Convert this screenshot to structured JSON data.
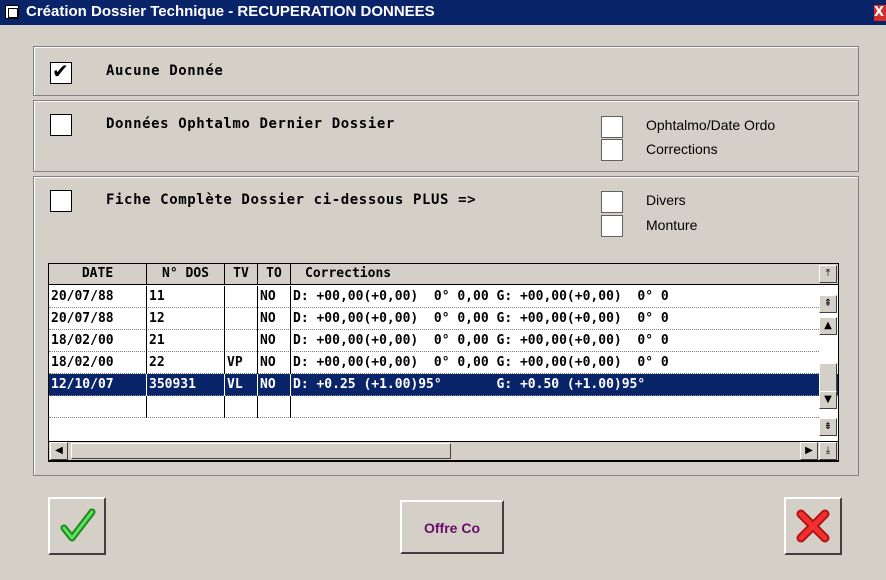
{
  "window": {
    "title": "Création Dossier Technique - RECUPERATION DONNEES",
    "close_glyph": "X"
  },
  "options": {
    "aucune": {
      "label": "Aucune Donnée",
      "checked": true
    },
    "ophtalmo_dernier": {
      "label": "Données Ophtalmo Dernier Dossier",
      "checked": false
    },
    "ophtalmo_date_ordo": {
      "label": "Ophtalmo/Date Ordo",
      "checked": false
    },
    "corrections": {
      "label": "Corrections",
      "checked": false
    },
    "fiche_complete": {
      "label": "Fiche Complète Dossier ci-dessous PLUS =>",
      "checked": false
    },
    "divers": {
      "label": "Divers",
      "checked": false
    },
    "monture": {
      "label": "Monture",
      "checked": false
    }
  },
  "table": {
    "headers": {
      "date": "DATE",
      "dos": "N° DOS",
      "tv": "TV",
      "to": "TO",
      "corrections": "Corrections"
    },
    "rows": [
      {
        "date": "20/07/88",
        "dos": "11",
        "tv": "",
        "to": "NO",
        "corrections": "D: +00,00(+0,00)  0° 0,00 G: +00,00(+0,00)  0° 0"
      },
      {
        "date": "20/07/88",
        "dos": "12",
        "tv": "",
        "to": "NO",
        "corrections": "D: +00,00(+0,00)  0° 0,00 G: +00,00(+0,00)  0° 0"
      },
      {
        "date": "18/02/00",
        "dos": "21",
        "tv": "",
        "to": "NO",
        "corrections": "D: +00,00(+0,00)  0° 0,00 G: +00,00(+0,00)  0° 0"
      },
      {
        "date": "18/02/00",
        "dos": "22",
        "tv": "VP",
        "to": "NO",
        "corrections": "D: +00,00(+0,00)  0° 0,00 G: +00,00(+0,00)  0° 0"
      },
      {
        "date": "12/10/07",
        "dos": "350931",
        "tv": "VL",
        "to": "NO",
        "corrections": "D: +0.25 (+1.00)95°       G: +0.50 (+1.00)95°"
      },
      {
        "date": "",
        "dos": "",
        "tv": "",
        "to": "",
        "corrections": ""
      }
    ],
    "selected_index": 4
  },
  "buttons": {
    "ok_icon": "checkmark-icon",
    "offre": "Offre Co",
    "cancel_icon": "cross-icon"
  },
  "colors": {
    "title_bar": "#0a246a",
    "selection": "#0a246a",
    "offre_text": "#6b0a6b",
    "ok_green": "#2fb52f",
    "cancel_red": "#e11b1b"
  }
}
